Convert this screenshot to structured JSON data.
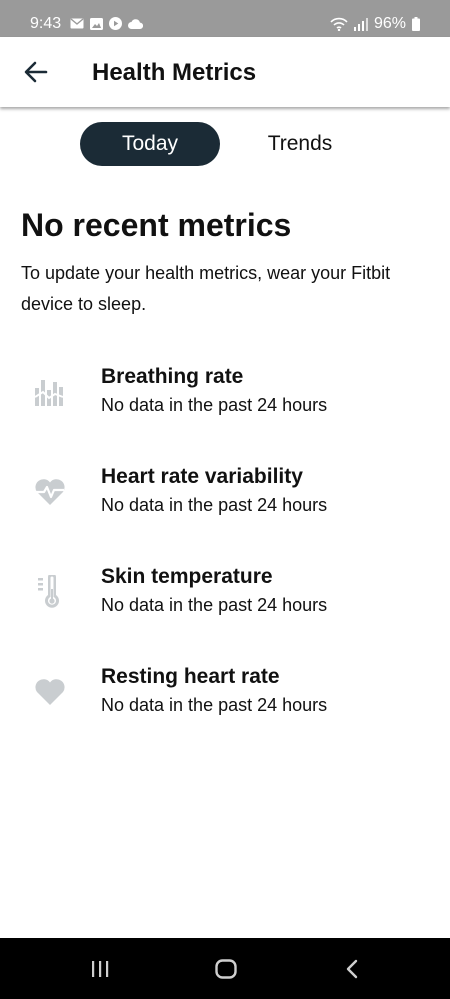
{
  "status_bar": {
    "time": "9:43",
    "battery": "96%"
  },
  "header": {
    "title": "Health Metrics"
  },
  "tabs": [
    {
      "label": "Today",
      "selected": true
    },
    {
      "label": "Trends",
      "selected": false
    }
  ],
  "main": {
    "heading": "No recent metrics",
    "description": "To update your health metrics, wear your Fitbit device to sleep.",
    "metrics": [
      {
        "name": "Breathing rate",
        "status": "No data in the past 24 hours",
        "icon": "breathing-rate-icon"
      },
      {
        "name": "Heart rate variability",
        "status": "No data in the past 24 hours",
        "icon": "heart-rate-variability-icon"
      },
      {
        "name": "Skin temperature",
        "status": "No data in the past 24 hours",
        "icon": "thermometer-icon"
      },
      {
        "name": "Resting heart rate",
        "status": "No data in the past 24 hours",
        "icon": "heart-icon"
      }
    ]
  },
  "colors": {
    "tab_selected_bg": "#1b2b36",
    "icon_gray": "#c9cdd0",
    "status_bar_bg": "#9a9a9a",
    "nav_bar_bg": "#000000"
  }
}
